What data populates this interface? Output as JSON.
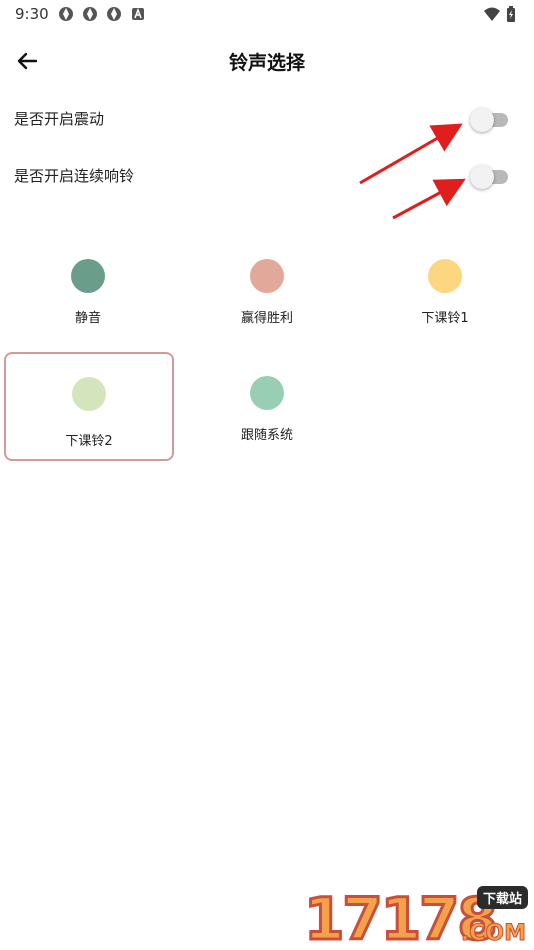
{
  "status_bar": {
    "time": "9:30",
    "left_icons": [
      "app-notification-icon",
      "app-notification-icon",
      "app-notification-icon",
      "a-notification-icon"
    ],
    "right_icons": [
      "wifi-icon",
      "battery-icon"
    ]
  },
  "header": {
    "title": "铃声选择",
    "back_icon": "arrow-left-icon"
  },
  "settings": {
    "vibrate": {
      "label": "是否开启震动",
      "enabled": false
    },
    "continuous": {
      "label": "是否开启连续响铃",
      "enabled": false
    }
  },
  "annotations": {
    "arrow_color": "#e01e1e"
  },
  "ringtones": [
    {
      "label": "静音",
      "color": "#6a9e8a",
      "selected": false
    },
    {
      "label": "赢得胜利",
      "color": "#e2a89a",
      "selected": false
    },
    {
      "label": "下课铃1",
      "color": "#fcd680",
      "selected": false
    },
    {
      "label": "下课铃2",
      "color": "#d4e5be",
      "selected": true
    },
    {
      "label": "跟随系统",
      "color": "#98ceb3",
      "selected": false
    }
  ],
  "watermark": {
    "digits": "17178",
    "tag": "下载站",
    "suffix": ".COM"
  },
  "colors": {
    "selected_border": "#d49a9a",
    "switch_track": "#b9b9b9",
    "switch_thumb": "#f2f2f2"
  }
}
